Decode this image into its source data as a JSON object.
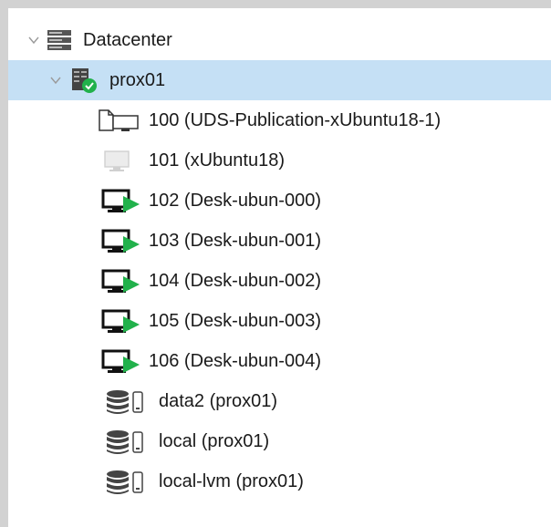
{
  "tree": {
    "datacenter": {
      "label": "Datacenter",
      "icon": "server-rack-icon"
    },
    "node": {
      "label": "prox01",
      "icon": "node-online-icon",
      "selected": true
    },
    "vms": [
      {
        "label": "100 (UDS-Publication-xUbuntu18-1)",
        "icon": "template-icon",
        "status": "template"
      },
      {
        "label": "101 (xUbuntu18)",
        "icon": "vm-stopped-icon",
        "status": "stopped"
      },
      {
        "label": "102 (Desk-ubun-000)",
        "icon": "vm-running-icon",
        "status": "running"
      },
      {
        "label": "103 (Desk-ubun-001)",
        "icon": "vm-running-icon",
        "status": "running"
      },
      {
        "label": "104 (Desk-ubun-002)",
        "icon": "vm-running-icon",
        "status": "running"
      },
      {
        "label": "105 (Desk-ubun-003)",
        "icon": "vm-running-icon",
        "status": "running"
      },
      {
        "label": "106 (Desk-ubun-004)",
        "icon": "vm-running-icon",
        "status": "running"
      }
    ],
    "storages": [
      {
        "label": "data2 (prox01)",
        "icon": "storage-icon"
      },
      {
        "label": "local (prox01)",
        "icon": "storage-icon"
      },
      {
        "label": "local-lvm (prox01)",
        "icon": "storage-icon"
      }
    ]
  },
  "colors": {
    "selection": "#c5e0f5",
    "running": "#21b14b",
    "online_badge": "#21b14b"
  }
}
